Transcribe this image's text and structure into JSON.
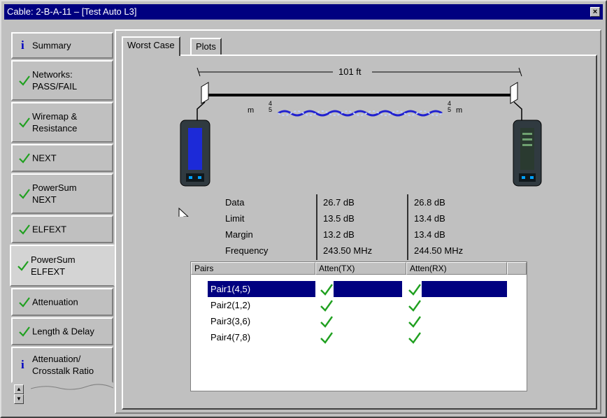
{
  "window": {
    "title": "Cable: 2-B-A-11 – [Test Auto L3]",
    "close_glyph": "×"
  },
  "sidebar": {
    "items": [
      {
        "label": "Summary",
        "status": "info"
      },
      {
        "label": "Networks:\nPASS/FAIL",
        "status": "pass"
      },
      {
        "label": "Wiremap &\nResistance",
        "status": "pass"
      },
      {
        "label": "NEXT",
        "status": "pass"
      },
      {
        "label": "PowerSum\nNEXT",
        "status": "pass"
      },
      {
        "label": "ELFEXT",
        "status": "pass"
      },
      {
        "label": "PowerSum\nELFEXT",
        "status": "pass",
        "active": true
      },
      {
        "label": "Attenuation",
        "status": "pass"
      },
      {
        "label": "Length & Delay",
        "status": "pass"
      },
      {
        "label": "Attenuation/\nCrosstalk Ratio",
        "status": "info"
      }
    ],
    "scroll_up": "▲",
    "scroll_down": "▼"
  },
  "tabs": [
    {
      "label": "Worst Case",
      "active": true
    },
    {
      "label": "Plots",
      "active": false
    }
  ],
  "diagram": {
    "length": "101 ft",
    "left_end_label": "m",
    "right_end_label": "m",
    "left_bracket": "4\n5",
    "right_bracket": "4\n5"
  },
  "measurements": {
    "labels": [
      "Data",
      "Limit",
      "Margin",
      "Frequency"
    ],
    "col1": [
      "26.7 dB",
      "13.5 dB",
      "13.2 dB",
      "243.50 MHz"
    ],
    "col2": [
      "26.8 dB",
      "13.4 dB",
      "13.4 dB",
      "244.50 MHz"
    ]
  },
  "table": {
    "headers": [
      "Pairs",
      "Atten(TX)",
      "Atten(RX)"
    ],
    "rows": [
      {
        "pair": "Pair1(4,5)",
        "tx": "pass",
        "rx": "pass",
        "selected": true
      },
      {
        "pair": "Pair2(1,2)",
        "tx": "pass",
        "rx": "pass",
        "selected": false
      },
      {
        "pair": "Pair3(3,6)",
        "tx": "pass",
        "rx": "pass",
        "selected": false
      },
      {
        "pair": "Pair4(7,8)",
        "tx": "pass",
        "rx": "pass",
        "selected": false
      }
    ]
  },
  "colors": {
    "title_bar": "#000080",
    "check": "#20a020",
    "info": "#0000c0",
    "cable_twist_blue": "#2020d0",
    "selection": "#000080"
  }
}
